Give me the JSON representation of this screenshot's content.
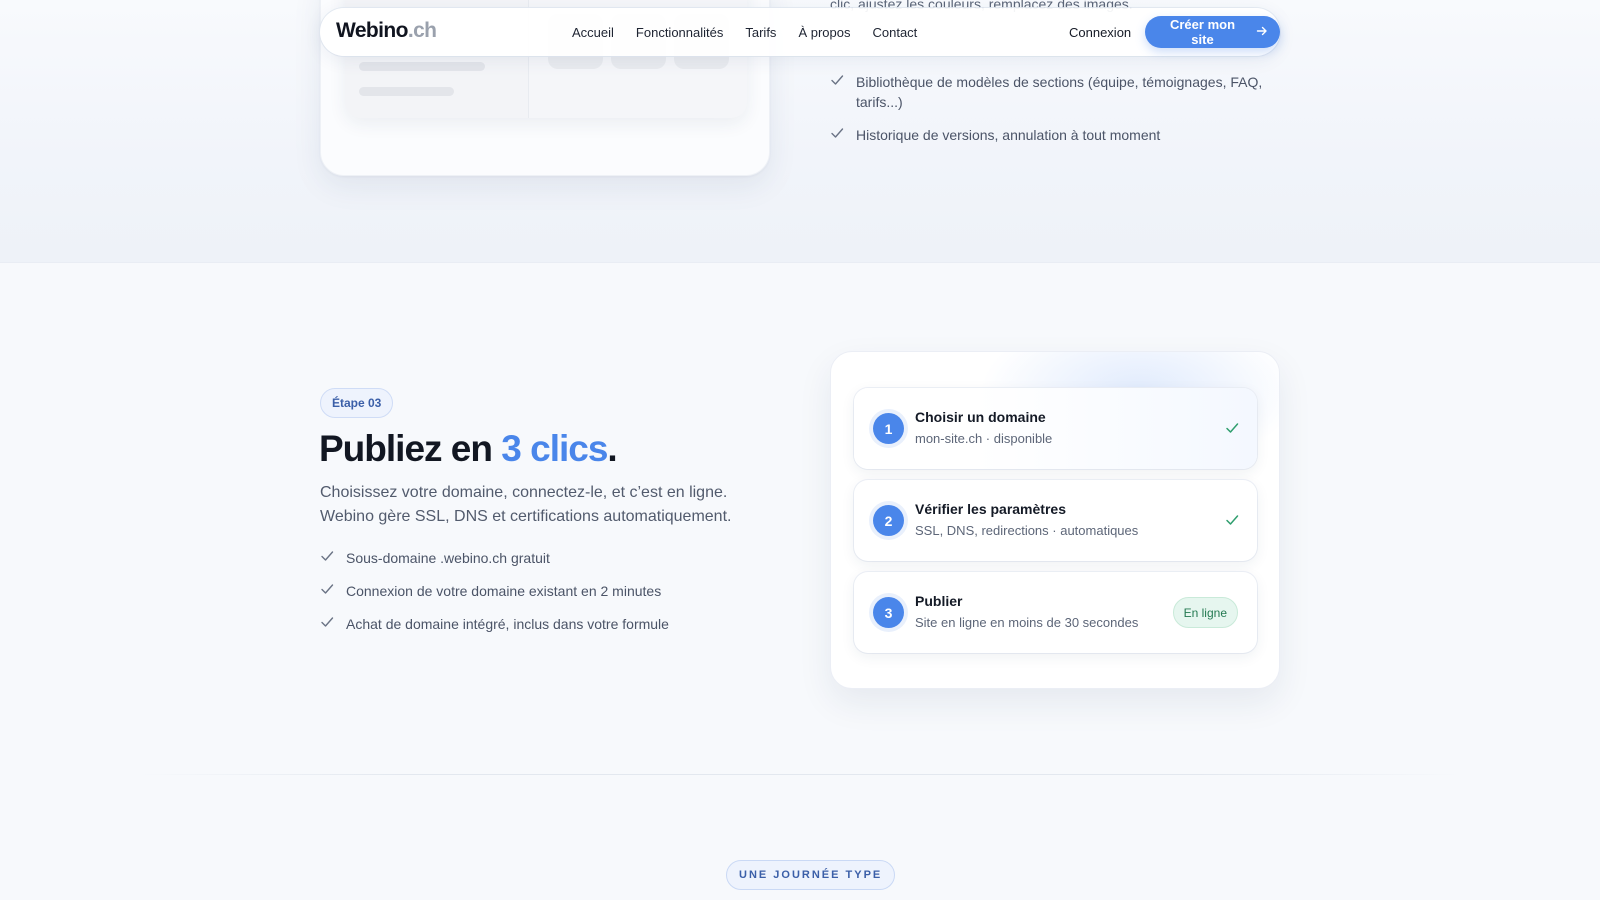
{
  "navbar": {
    "logo_main": "Webino",
    "logo_tld": ".ch",
    "links": [
      "Accueil",
      "Fonctionnalités",
      "Tarifs",
      "À propos",
      "Contact"
    ],
    "login_label": "Connexion",
    "cta_label": "Créer mon site"
  },
  "previous_section": {
    "partial_text": "clic, ajustez les couleurs, remplacez des images.",
    "features": [
      "Bibliothèque de modèles de sections (équipe, témoignages, FAQ, tarifs...)",
      "Historique de versions, annulation à tout moment"
    ]
  },
  "step": {
    "badge": "Étape 03",
    "headline_before": "Publiez en",
    "headline_accent": "3 clics",
    "headline_after": ".",
    "lead": "Choisissez votre domaine, connectez-le, et c’est en ligne. Webino gère SSL, DNS et certifications automatiquement.",
    "features": [
      "Sous-domaine .webino.ch gratuit",
      "Connexion de votre domaine existant en 2 minutes",
      "Achat de domaine intégré, inclus dans votre formule"
    ]
  },
  "steps_card": {
    "steps": [
      {
        "number": "1",
        "title": "Choisir un domaine",
        "subtitle": "mon-site.ch · disponible",
        "status": "check"
      },
      {
        "number": "2",
        "title": "Vérifier les paramètres",
        "subtitle": "SSL, DNS, redirections · automatiques",
        "status": "check"
      },
      {
        "number": "3",
        "title": "Publier",
        "subtitle": "Site en ligne en moins de 30 secondes",
        "status": "badge"
      }
    ],
    "live_badge": "En ligne"
  },
  "next_section": {
    "eyebrow": "UNE JOURNÉE TYPE"
  },
  "colors": {
    "accent": "#4a86ea",
    "success": "#2f9e6e",
    "text": "#121722"
  }
}
